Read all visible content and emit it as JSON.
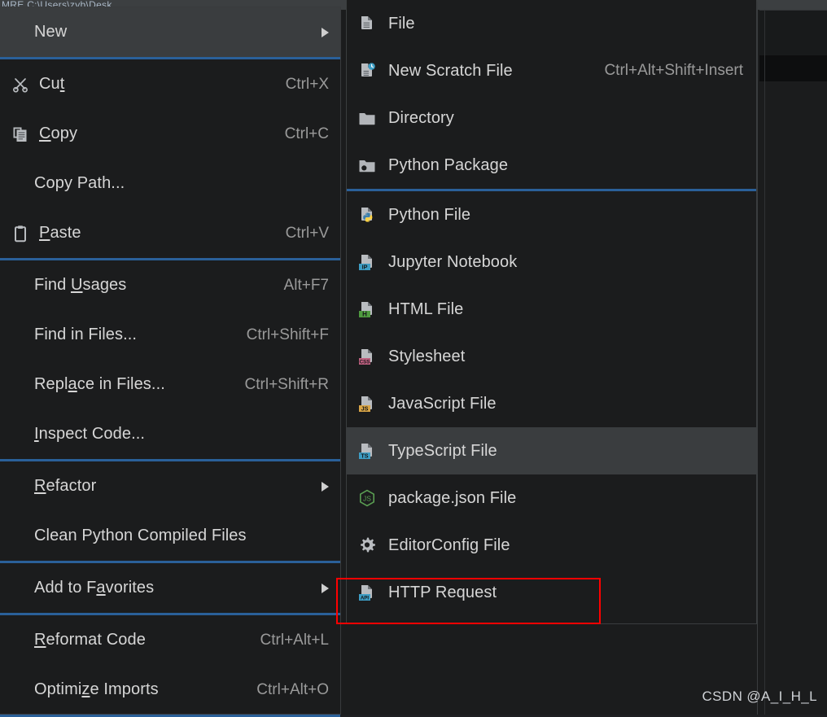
{
  "background": {
    "title_bar_text": "MRE C:\\Users\\zyb\\Desk",
    "watermark": "CSDN @A_I_H_L"
  },
  "colors": {
    "menu_bg": "#1b1c1d",
    "menu_selected_bg": "#3a3d3f",
    "separator_blue": "#2a6099",
    "text": "#d6d6d6",
    "accel_text": "#9a9a9a",
    "highlight_rect": "#ff0000",
    "python_yellow": "#ffd343",
    "python_blue": "#3b7eab",
    "jupyter_blue": "#3d9dc4",
    "html_green": "#4f9a3f",
    "css_pink": "#c06080",
    "js_orange": "#d9a547",
    "ts_blue": "#3d9dc4",
    "node_green": "#5a9e52",
    "api_blue": "#3d9dc4"
  },
  "context_menu": {
    "items": [
      {
        "type": "item",
        "name": "new",
        "label": "New",
        "label_pre": "New",
        "accel": "",
        "icon": "",
        "submenu": true,
        "selected": true
      },
      {
        "type": "sep"
      },
      {
        "type": "item",
        "name": "cut",
        "label": "Cut",
        "label_pre": "Cu",
        "label_u": "t",
        "label_post": "",
        "accel": "Ctrl+X",
        "icon": "scissors-icon",
        "submenu": false,
        "selected": false
      },
      {
        "type": "item",
        "name": "copy",
        "label": "Copy",
        "label_pre": "",
        "label_u": "C",
        "label_post": "opy",
        "accel": "Ctrl+C",
        "icon": "copy-icon",
        "submenu": false,
        "selected": false
      },
      {
        "type": "item",
        "name": "copy-path",
        "label": "Copy Path...",
        "accel": "",
        "icon": "",
        "submenu": false,
        "selected": false
      },
      {
        "type": "item",
        "name": "paste",
        "label": "Paste",
        "label_pre": "",
        "label_u": "P",
        "label_post": "aste",
        "accel": "Ctrl+V",
        "icon": "clipboard-icon",
        "submenu": false,
        "selected": false
      },
      {
        "type": "sep"
      },
      {
        "type": "item",
        "name": "find-usages",
        "label": "Find Usages",
        "label_pre": "Find ",
        "label_u": "U",
        "label_post": "sages",
        "accel": "Alt+F7",
        "icon": "",
        "submenu": false,
        "selected": false
      },
      {
        "type": "item",
        "name": "find-in-files",
        "label": "Find in Files...",
        "accel": "Ctrl+Shift+F",
        "icon": "",
        "submenu": false,
        "selected": false
      },
      {
        "type": "item",
        "name": "replace-in-files",
        "label": "Replace in Files...",
        "label_pre": "Repl",
        "label_u": "a",
        "label_post": "ce in Files...",
        "accel": "Ctrl+Shift+R",
        "icon": "",
        "submenu": false,
        "selected": false
      },
      {
        "type": "item",
        "name": "inspect-code",
        "label": "Inspect Code...",
        "label_pre": "",
        "label_u": "I",
        "label_post": "nspect Code...",
        "accel": "",
        "icon": "",
        "submenu": false,
        "selected": false
      },
      {
        "type": "sep"
      },
      {
        "type": "item",
        "name": "refactor",
        "label": "Refactor",
        "label_pre": "",
        "label_u": "R",
        "label_post": "efactor",
        "accel": "",
        "icon": "",
        "submenu": true,
        "selected": false
      },
      {
        "type": "item",
        "name": "clean-python-compiled-files",
        "label": "Clean Python Compiled Files",
        "accel": "",
        "icon": "",
        "submenu": false,
        "selected": false
      },
      {
        "type": "sep"
      },
      {
        "type": "item",
        "name": "add-to-favorites",
        "label": "Add to Favorites",
        "label_pre": "Add to F",
        "label_u": "a",
        "label_post": "vorites",
        "accel": "",
        "icon": "",
        "submenu": true,
        "selected": false
      },
      {
        "type": "sep"
      },
      {
        "type": "item",
        "name": "reformat-code",
        "label": "Reformat Code",
        "label_pre": "",
        "label_u": "R",
        "label_post": "eformat Code",
        "accel": "Ctrl+Alt+L",
        "icon": "",
        "submenu": false,
        "selected": false
      },
      {
        "type": "item",
        "name": "optimize-imports",
        "label": "Optimize Imports",
        "label_pre": "Optimi",
        "label_u": "z",
        "label_post": "e Imports",
        "accel": "Ctrl+Alt+O",
        "icon": "",
        "submenu": false,
        "selected": false
      },
      {
        "type": "sep"
      }
    ]
  },
  "new_submenu": {
    "items": [
      {
        "type": "item",
        "name": "file",
        "label": "File",
        "accel": "",
        "icon": "file-icon",
        "selected": false,
        "highlighted": false
      },
      {
        "type": "item",
        "name": "new-scratch-file",
        "label": "New Scratch File",
        "accel": "Ctrl+Alt+Shift+Insert",
        "icon": "scratch-file-icon",
        "selected": false,
        "highlighted": false
      },
      {
        "type": "item",
        "name": "directory",
        "label": "Directory",
        "accel": "",
        "icon": "folder-icon",
        "selected": false,
        "highlighted": false
      },
      {
        "type": "item",
        "name": "python-package",
        "label": "Python Package",
        "accel": "",
        "icon": "package-icon",
        "selected": false,
        "highlighted": false
      },
      {
        "type": "sep"
      },
      {
        "type": "item",
        "name": "python-file",
        "label": "Python File",
        "accel": "",
        "icon": "python-file-icon",
        "selected": false,
        "highlighted": false
      },
      {
        "type": "item",
        "name": "jupyter-notebook",
        "label": "Jupyter Notebook",
        "accel": "",
        "icon": "jupyter-file-icon",
        "badge": "IP",
        "selected": false,
        "highlighted": false
      },
      {
        "type": "item",
        "name": "html-file",
        "label": "HTML File",
        "accel": "",
        "icon": "html-file-icon",
        "badge": "H",
        "selected": false,
        "highlighted": false
      },
      {
        "type": "item",
        "name": "stylesheet",
        "label": "Stylesheet",
        "accel": "",
        "icon": "css-file-icon",
        "badge": "CSS",
        "selected": false,
        "highlighted": false
      },
      {
        "type": "item",
        "name": "javascript-file",
        "label": "JavaScript File",
        "accel": "",
        "icon": "js-file-icon",
        "badge": "JS",
        "selected": false,
        "highlighted": false
      },
      {
        "type": "item",
        "name": "typescript-file",
        "label": "TypeScript File",
        "accel": "",
        "icon": "ts-file-icon",
        "badge": "TS",
        "selected": true,
        "highlighted": false
      },
      {
        "type": "item",
        "name": "package-json-file",
        "label": "package.json File",
        "accel": "",
        "icon": "nodejs-icon",
        "selected": false,
        "highlighted": false
      },
      {
        "type": "item",
        "name": "editorconfig-file",
        "label": "EditorConfig File",
        "accel": "",
        "icon": "gear-icon",
        "selected": false,
        "highlighted": false
      },
      {
        "type": "item",
        "name": "http-request",
        "label": "HTTP Request",
        "accel": "",
        "icon": "api-file-icon",
        "badge": "API",
        "selected": false,
        "highlighted": true
      }
    ]
  }
}
